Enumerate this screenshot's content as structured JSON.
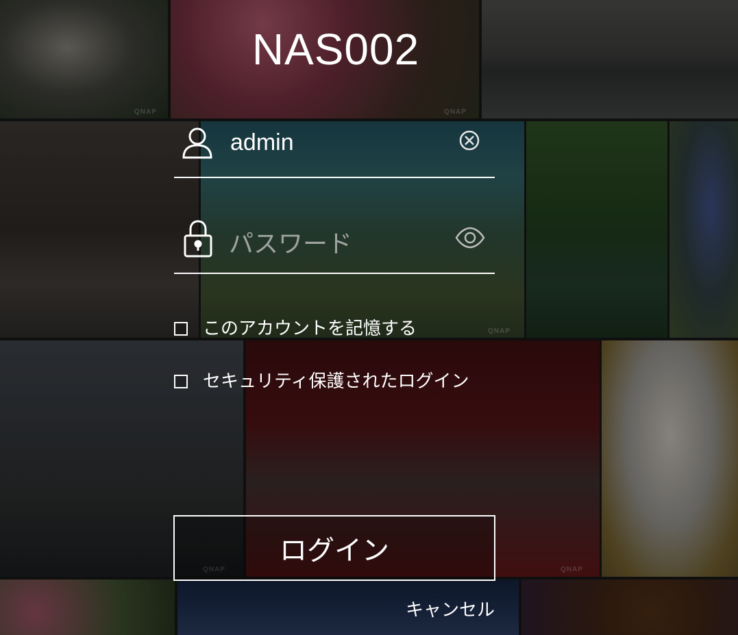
{
  "nas_name": "NAS002",
  "username": {
    "value": "admin",
    "icon": "user-icon",
    "clear_icon": "clear-icon"
  },
  "password": {
    "placeholder": "パスワード",
    "icon": "lock-icon",
    "reveal_icon": "eye-icon"
  },
  "options": {
    "remember_label": "このアカウントを記憶する",
    "remember_checked": false,
    "secure_label": "セキュリティ保護されたログイン",
    "secure_checked": false
  },
  "login_label": "ログイン",
  "cancel_label": "キャンセル",
  "tile_watermark": "QNAP",
  "colors": {
    "text": "#ffffff",
    "field_underline": "#ffffff",
    "placeholder": "#bfbfbf"
  }
}
